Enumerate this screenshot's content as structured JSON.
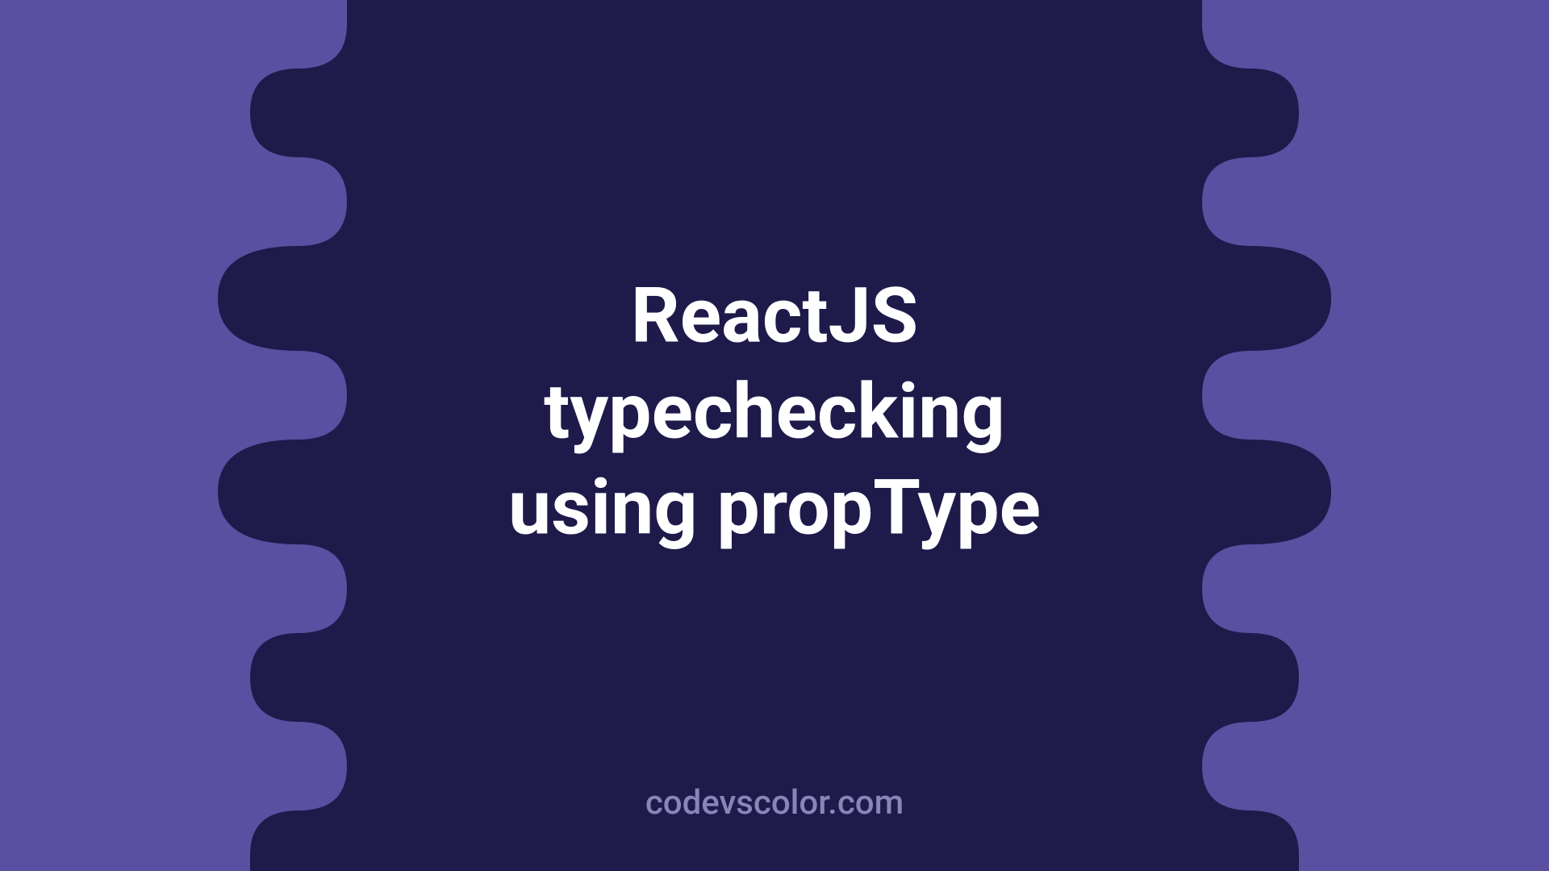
{
  "title": {
    "line1": "ReactJS",
    "line2": "typechecking",
    "line3": "using propType"
  },
  "watermark": "codevscolor.com",
  "colors": {
    "background": "#5a4fa0",
    "blob": "#1e1a4a",
    "title_text": "#ffffff",
    "watermark_text": "#8a85b8"
  }
}
